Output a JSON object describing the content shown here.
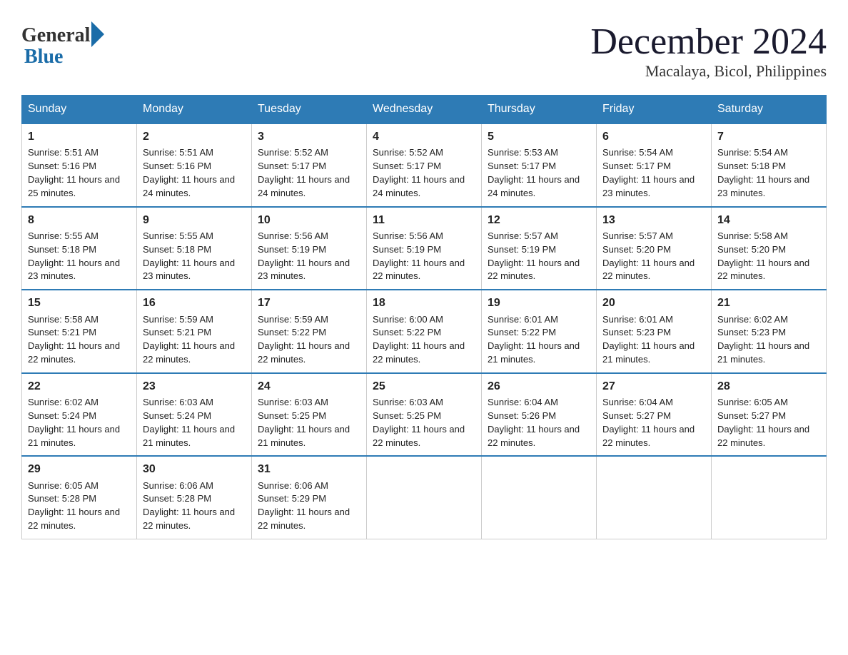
{
  "logo": {
    "general": "General",
    "blue": "Blue"
  },
  "title": "December 2024",
  "location": "Macalaya, Bicol, Philippines",
  "days_header": [
    "Sunday",
    "Monday",
    "Tuesday",
    "Wednesday",
    "Thursday",
    "Friday",
    "Saturday"
  ],
  "weeks": [
    [
      {
        "day": "1",
        "sunrise": "5:51 AM",
        "sunset": "5:16 PM",
        "daylight": "11 hours and 25 minutes."
      },
      {
        "day": "2",
        "sunrise": "5:51 AM",
        "sunset": "5:16 PM",
        "daylight": "11 hours and 24 minutes."
      },
      {
        "day": "3",
        "sunrise": "5:52 AM",
        "sunset": "5:17 PM",
        "daylight": "11 hours and 24 minutes."
      },
      {
        "day": "4",
        "sunrise": "5:52 AM",
        "sunset": "5:17 PM",
        "daylight": "11 hours and 24 minutes."
      },
      {
        "day": "5",
        "sunrise": "5:53 AM",
        "sunset": "5:17 PM",
        "daylight": "11 hours and 24 minutes."
      },
      {
        "day": "6",
        "sunrise": "5:54 AM",
        "sunset": "5:17 PM",
        "daylight": "11 hours and 23 minutes."
      },
      {
        "day": "7",
        "sunrise": "5:54 AM",
        "sunset": "5:18 PM",
        "daylight": "11 hours and 23 minutes."
      }
    ],
    [
      {
        "day": "8",
        "sunrise": "5:55 AM",
        "sunset": "5:18 PM",
        "daylight": "11 hours and 23 minutes."
      },
      {
        "day": "9",
        "sunrise": "5:55 AM",
        "sunset": "5:18 PM",
        "daylight": "11 hours and 23 minutes."
      },
      {
        "day": "10",
        "sunrise": "5:56 AM",
        "sunset": "5:19 PM",
        "daylight": "11 hours and 23 minutes."
      },
      {
        "day": "11",
        "sunrise": "5:56 AM",
        "sunset": "5:19 PM",
        "daylight": "11 hours and 22 minutes."
      },
      {
        "day": "12",
        "sunrise": "5:57 AM",
        "sunset": "5:19 PM",
        "daylight": "11 hours and 22 minutes."
      },
      {
        "day": "13",
        "sunrise": "5:57 AM",
        "sunset": "5:20 PM",
        "daylight": "11 hours and 22 minutes."
      },
      {
        "day": "14",
        "sunrise": "5:58 AM",
        "sunset": "5:20 PM",
        "daylight": "11 hours and 22 minutes."
      }
    ],
    [
      {
        "day": "15",
        "sunrise": "5:58 AM",
        "sunset": "5:21 PM",
        "daylight": "11 hours and 22 minutes."
      },
      {
        "day": "16",
        "sunrise": "5:59 AM",
        "sunset": "5:21 PM",
        "daylight": "11 hours and 22 minutes."
      },
      {
        "day": "17",
        "sunrise": "5:59 AM",
        "sunset": "5:22 PM",
        "daylight": "11 hours and 22 minutes."
      },
      {
        "day": "18",
        "sunrise": "6:00 AM",
        "sunset": "5:22 PM",
        "daylight": "11 hours and 22 minutes."
      },
      {
        "day": "19",
        "sunrise": "6:01 AM",
        "sunset": "5:22 PM",
        "daylight": "11 hours and 21 minutes."
      },
      {
        "day": "20",
        "sunrise": "6:01 AM",
        "sunset": "5:23 PM",
        "daylight": "11 hours and 21 minutes."
      },
      {
        "day": "21",
        "sunrise": "6:02 AM",
        "sunset": "5:23 PM",
        "daylight": "11 hours and 21 minutes."
      }
    ],
    [
      {
        "day": "22",
        "sunrise": "6:02 AM",
        "sunset": "5:24 PM",
        "daylight": "11 hours and 21 minutes."
      },
      {
        "day": "23",
        "sunrise": "6:03 AM",
        "sunset": "5:24 PM",
        "daylight": "11 hours and 21 minutes."
      },
      {
        "day": "24",
        "sunrise": "6:03 AM",
        "sunset": "5:25 PM",
        "daylight": "11 hours and 21 minutes."
      },
      {
        "day": "25",
        "sunrise": "6:03 AM",
        "sunset": "5:25 PM",
        "daylight": "11 hours and 22 minutes."
      },
      {
        "day": "26",
        "sunrise": "6:04 AM",
        "sunset": "5:26 PM",
        "daylight": "11 hours and 22 minutes."
      },
      {
        "day": "27",
        "sunrise": "6:04 AM",
        "sunset": "5:27 PM",
        "daylight": "11 hours and 22 minutes."
      },
      {
        "day": "28",
        "sunrise": "6:05 AM",
        "sunset": "5:27 PM",
        "daylight": "11 hours and 22 minutes."
      }
    ],
    [
      {
        "day": "29",
        "sunrise": "6:05 AM",
        "sunset": "5:28 PM",
        "daylight": "11 hours and 22 minutes."
      },
      {
        "day": "30",
        "sunrise": "6:06 AM",
        "sunset": "5:28 PM",
        "daylight": "11 hours and 22 minutes."
      },
      {
        "day": "31",
        "sunrise": "6:06 AM",
        "sunset": "5:29 PM",
        "daylight": "11 hours and 22 minutes."
      },
      null,
      null,
      null,
      null
    ]
  ]
}
